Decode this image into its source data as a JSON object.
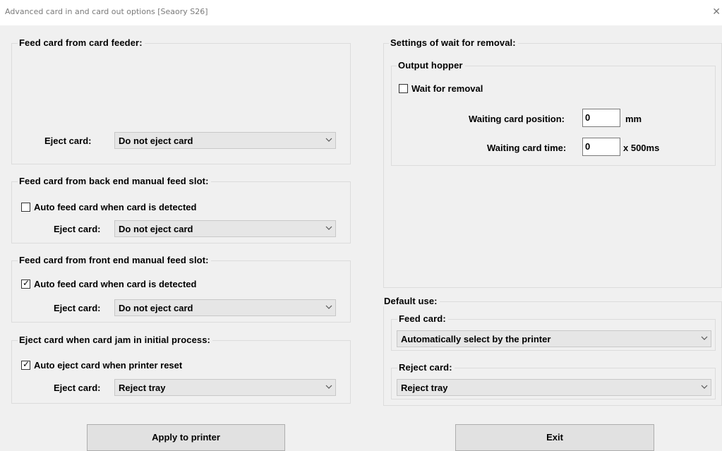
{
  "window": {
    "title": "Advanced card in and card out options  [Seaory S26]"
  },
  "feeder": {
    "legend": "Feed card from card feeder:",
    "eject_label": "Eject card:",
    "eject_value": "Do not eject card"
  },
  "back_slot": {
    "legend": "Feed card from back end manual feed slot:",
    "checkbox_label": "Auto feed card when card is detected",
    "checked": false,
    "eject_label": "Eject card:",
    "eject_value": "Do not eject card"
  },
  "front_slot": {
    "legend": "Feed card from front end manual feed slot:",
    "checkbox_label": "Auto feed card when card is detected",
    "checked": true,
    "eject_label": "Eject card:",
    "eject_value": "Do not eject card"
  },
  "jam": {
    "legend": "Eject card when card jam in initial process:",
    "checkbox_label": "Auto eject card when printer reset",
    "checked": true,
    "eject_label": "Eject card:",
    "eject_value": "Reject tray"
  },
  "removal": {
    "legend": "Settings of wait for removal:",
    "hopper_legend": "Output hopper",
    "checkbox_label": "Wait for removal",
    "checked": false,
    "position_label": "Waiting card position:",
    "position_value": "0",
    "position_unit": "mm",
    "time_label": "Waiting card time:",
    "time_value": "0",
    "time_unit": "x 500ms"
  },
  "default_use": {
    "legend": "Default use:",
    "feed_legend": "Feed card:",
    "feed_value": "Automatically select by the printer",
    "reject_legend": "Reject card:",
    "reject_value": "Reject tray"
  },
  "buttons": {
    "apply": "Apply to printer",
    "exit": "Exit"
  },
  "glyphs": {
    "check": "✓",
    "close": "✕"
  }
}
